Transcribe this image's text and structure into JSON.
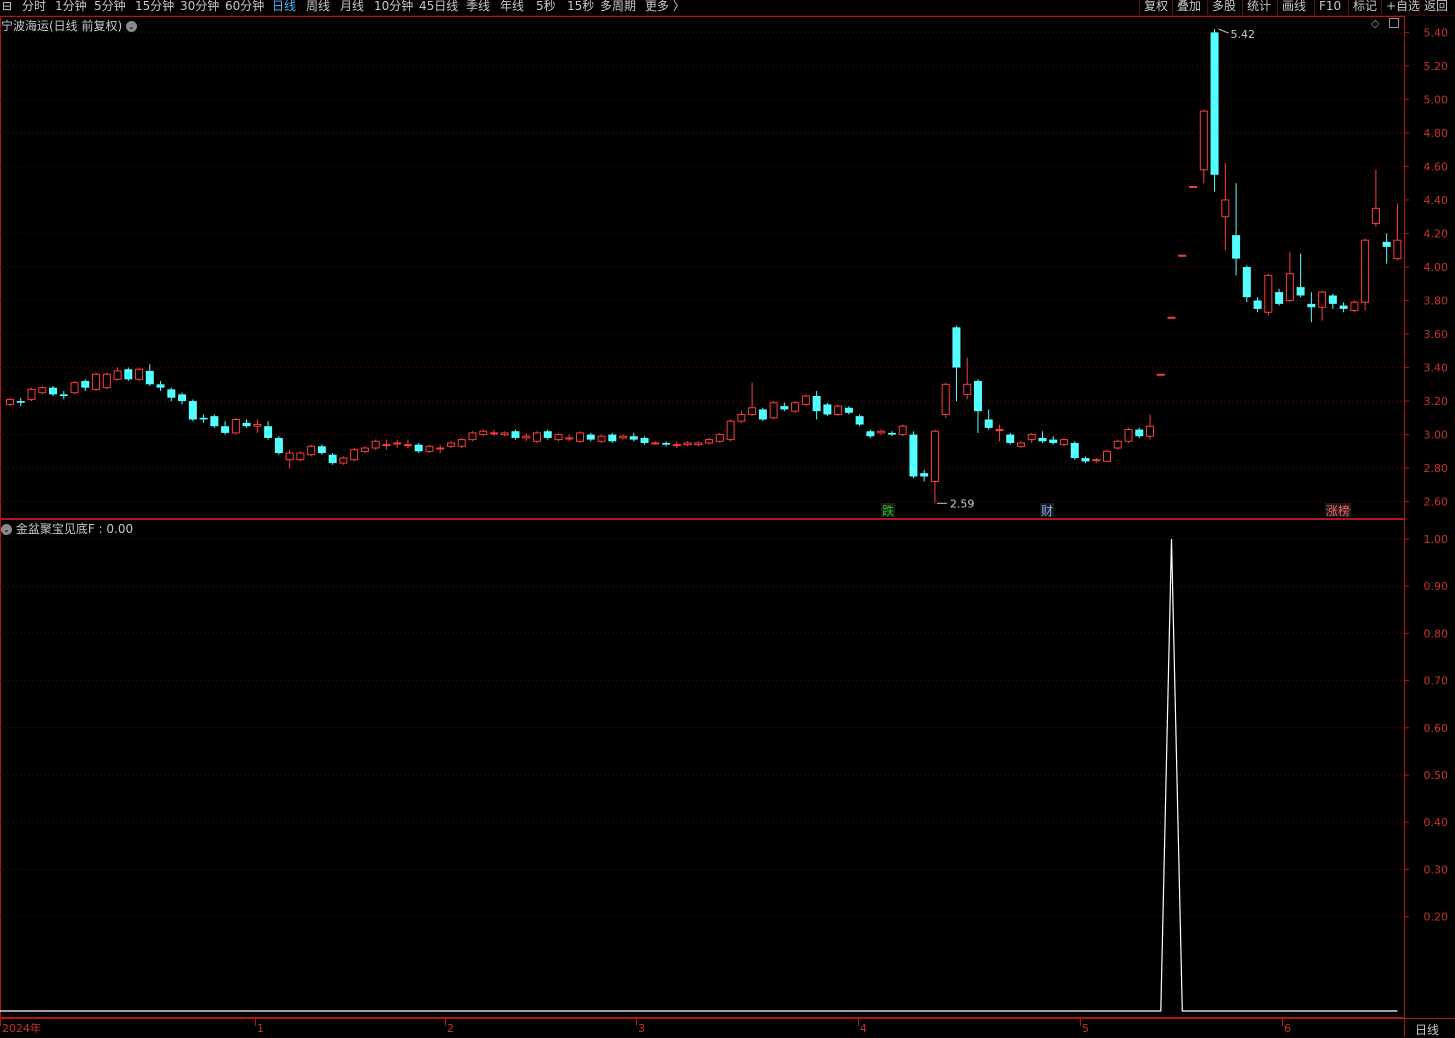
{
  "toolbar": {
    "periods": [
      "分时",
      "1分钟",
      "5分钟",
      "15分钟",
      "30分钟",
      "60分钟",
      "日线",
      "周线",
      "月线",
      "10分钟",
      "45日线",
      "季线",
      "年线",
      "5秒",
      "15秒",
      "多周期",
      "更多 〉"
    ],
    "active_period": "日线",
    "right_buttons": [
      "复权",
      "叠加",
      "多股",
      "统计",
      "画线",
      "F10",
      "标记",
      "+自选",
      "返回"
    ]
  },
  "main_panel": {
    "title": "宁波海运(日线 前复权)",
    "high_label": "5.42",
    "low_label": "2.59",
    "markers": [
      {
        "text": "跌",
        "color": "#27c227"
      },
      {
        "text": "财",
        "color": "#7fb0ff"
      },
      {
        "text": "涨榜",
        "color": "#ff6060"
      }
    ]
  },
  "indicator_panel": {
    "title": "金盆聚宝见底F : 0.00",
    "axis_ticks": [
      "1.00",
      "0.90",
      "0.80",
      "0.70",
      "0.60",
      "0.50",
      "0.40",
      "0.30",
      "0.20"
    ]
  },
  "time_axis": {
    "labels": [
      "2024年",
      "1",
      "2",
      "3",
      "4",
      "5",
      "6"
    ],
    "period_label": "日线"
  },
  "colors": {
    "up": "#ff3c3c",
    "down": "#54ffff",
    "grid": "#7a0000",
    "axis_text": "#c8342e",
    "frame": "#b01818"
  },
  "chart_data": [
    {
      "type": "candlestick",
      "name": "宁波海运",
      "ylim": [
        2.55,
        5.45
      ],
      "yticks": [
        2.6,
        2.8,
        3.0,
        3.2,
        3.4,
        3.6,
        3.8,
        4.0,
        4.2,
        4.4,
        4.6,
        4.8,
        5.0,
        5.2,
        5.4
      ],
      "candles": [
        {
          "o": 3.18,
          "c": 3.21,
          "h": 3.22,
          "l": 3.17
        },
        {
          "o": 3.2,
          "c": 3.19,
          "h": 3.22,
          "l": 3.17
        },
        {
          "o": 3.21,
          "c": 3.27,
          "h": 3.28,
          "l": 3.2
        },
        {
          "o": 3.25,
          "c": 3.28,
          "h": 3.29,
          "l": 3.24
        },
        {
          "o": 3.28,
          "c": 3.24,
          "h": 3.29,
          "l": 3.23
        },
        {
          "o": 3.24,
          "c": 3.23,
          "h": 3.26,
          "l": 3.21
        },
        {
          "o": 3.25,
          "c": 3.31,
          "h": 3.32,
          "l": 3.24
        },
        {
          "o": 3.32,
          "c": 3.28,
          "h": 3.33,
          "l": 3.26
        },
        {
          "o": 3.27,
          "c": 3.36,
          "h": 3.37,
          "l": 3.26
        },
        {
          "o": 3.28,
          "c": 3.36,
          "h": 3.37,
          "l": 3.27
        },
        {
          "o": 3.33,
          "c": 3.38,
          "h": 3.4,
          "l": 3.32
        },
        {
          "o": 3.39,
          "c": 3.33,
          "h": 3.4,
          "l": 3.32
        },
        {
          "o": 3.33,
          "c": 3.39,
          "h": 3.4,
          "l": 3.32
        },
        {
          "o": 3.38,
          "c": 3.3,
          "h": 3.42,
          "l": 3.29
        },
        {
          "o": 3.3,
          "c": 3.28,
          "h": 3.32,
          "l": 3.26
        },
        {
          "o": 3.27,
          "c": 3.22,
          "h": 3.28,
          "l": 3.2
        },
        {
          "o": 3.24,
          "c": 3.2,
          "h": 3.25,
          "l": 3.18
        },
        {
          "o": 3.2,
          "c": 3.09,
          "h": 3.21,
          "l": 3.08
        },
        {
          "o": 3.1,
          "c": 3.09,
          "h": 3.12,
          "l": 3.07
        },
        {
          "o": 3.11,
          "c": 3.05,
          "h": 3.12,
          "l": 3.04
        },
        {
          "o": 3.05,
          "c": 3.01,
          "h": 3.08,
          "l": 3.0
        },
        {
          "o": 3.01,
          "c": 3.09,
          "h": 3.1,
          "l": 3.0
        },
        {
          "o": 3.07,
          "c": 3.05,
          "h": 3.09,
          "l": 3.04
        },
        {
          "o": 3.05,
          "c": 3.06,
          "h": 3.09,
          "l": 3.01
        },
        {
          "o": 3.05,
          "c": 2.98,
          "h": 3.08,
          "l": 2.97
        },
        {
          "o": 2.98,
          "c": 2.89,
          "h": 2.99,
          "l": 2.88
        },
        {
          "o": 2.85,
          "c": 2.89,
          "h": 2.91,
          "l": 2.8
        },
        {
          "o": 2.85,
          "c": 2.89,
          "h": 2.9,
          "l": 2.84
        },
        {
          "o": 2.88,
          "c": 2.93,
          "h": 2.94,
          "l": 2.87
        },
        {
          "o": 2.93,
          "c": 2.89,
          "h": 2.94,
          "l": 2.88
        },
        {
          "o": 2.88,
          "c": 2.83,
          "h": 2.89,
          "l": 2.82
        },
        {
          "o": 2.83,
          "c": 2.86,
          "h": 2.87,
          "l": 2.82
        },
        {
          "o": 2.85,
          "c": 2.91,
          "h": 2.92,
          "l": 2.84
        },
        {
          "o": 2.9,
          "c": 2.92,
          "h": 2.93,
          "l": 2.89
        },
        {
          "o": 2.92,
          "c": 2.96,
          "h": 2.97,
          "l": 2.91
        },
        {
          "o": 2.94,
          "c": 2.94,
          "h": 2.97,
          "l": 2.91
        },
        {
          "o": 2.95,
          "c": 2.95,
          "h": 2.97,
          "l": 2.92
        },
        {
          "o": 2.94,
          "c": 2.94,
          "h": 2.97,
          "l": 2.92
        },
        {
          "o": 2.94,
          "c": 2.9,
          "h": 2.95,
          "l": 2.89
        },
        {
          "o": 2.9,
          "c": 2.93,
          "h": 2.94,
          "l": 2.89
        },
        {
          "o": 2.92,
          "c": 2.92,
          "h": 2.94,
          "l": 2.89
        },
        {
          "o": 2.93,
          "c": 2.95,
          "h": 2.96,
          "l": 2.92
        },
        {
          "o": 2.93,
          "c": 2.97,
          "h": 2.98,
          "l": 2.92
        },
        {
          "o": 2.97,
          "c": 3.01,
          "h": 3.02,
          "l": 2.96
        },
        {
          "o": 3.0,
          "c": 3.02,
          "h": 3.03,
          "l": 2.99
        },
        {
          "o": 3.01,
          "c": 3.01,
          "h": 3.03,
          "l": 2.99
        },
        {
          "o": 3.0,
          "c": 3.01,
          "h": 3.02,
          "l": 2.99
        },
        {
          "o": 3.02,
          "c": 2.98,
          "h": 3.03,
          "l": 2.97
        },
        {
          "o": 2.98,
          "c": 2.99,
          "h": 3.01,
          "l": 2.96
        },
        {
          "o": 2.96,
          "c": 3.01,
          "h": 3.02,
          "l": 2.95
        },
        {
          "o": 3.02,
          "c": 2.98,
          "h": 3.03,
          "l": 2.97
        },
        {
          "o": 2.97,
          "c": 3.0,
          "h": 3.01,
          "l": 2.96
        },
        {
          "o": 2.98,
          "c": 2.98,
          "h": 3.0,
          "l": 2.96
        },
        {
          "o": 2.96,
          "c": 3.01,
          "h": 3.02,
          "l": 2.95
        },
        {
          "o": 3.0,
          "c": 2.97,
          "h": 3.01,
          "l": 2.96
        },
        {
          "o": 2.96,
          "c": 2.99,
          "h": 3.0,
          "l": 2.95
        },
        {
          "o": 3.0,
          "c": 2.96,
          "h": 3.01,
          "l": 2.95
        },
        {
          "o": 2.98,
          "c": 2.99,
          "h": 3.0,
          "l": 2.97
        },
        {
          "o": 2.99,
          "c": 2.97,
          "h": 3.01,
          "l": 2.96
        },
        {
          "o": 2.98,
          "c": 2.95,
          "h": 2.99,
          "l": 2.94
        },
        {
          "o": 2.95,
          "c": 2.95,
          "h": 2.96,
          "l": 2.94
        },
        {
          "o": 2.95,
          "c": 2.94,
          "h": 2.96,
          "l": 2.93
        },
        {
          "o": 2.94,
          "c": 2.94,
          "h": 2.96,
          "l": 2.92
        },
        {
          "o": 2.94,
          "c": 2.95,
          "h": 2.96,
          "l": 2.93
        },
        {
          "o": 2.94,
          "c": 2.95,
          "h": 2.96,
          "l": 2.93
        },
        {
          "o": 2.95,
          "c": 2.97,
          "h": 2.98,
          "l": 2.94
        },
        {
          "o": 2.96,
          "c": 3.0,
          "h": 3.01,
          "l": 2.95
        },
        {
          "o": 2.97,
          "c": 3.08,
          "h": 3.09,
          "l": 2.96
        },
        {
          "o": 3.08,
          "c": 3.12,
          "h": 3.14,
          "l": 3.07
        },
        {
          "o": 3.12,
          "c": 3.16,
          "h": 3.31,
          "l": 3.11
        },
        {
          "o": 3.15,
          "c": 3.09,
          "h": 3.16,
          "l": 3.08
        },
        {
          "o": 3.1,
          "c": 3.19,
          "h": 3.2,
          "l": 3.09
        },
        {
          "o": 3.17,
          "c": 3.15,
          "h": 3.19,
          "l": 3.14
        },
        {
          "o": 3.14,
          "c": 3.19,
          "h": 3.2,
          "l": 3.13
        },
        {
          "o": 3.18,
          "c": 3.23,
          "h": 3.24,
          "l": 3.17
        },
        {
          "o": 3.23,
          "c": 3.14,
          "h": 3.26,
          "l": 3.09
        },
        {
          "o": 3.18,
          "c": 3.12,
          "h": 3.19,
          "l": 3.11
        },
        {
          "o": 3.12,
          "c": 3.17,
          "h": 3.18,
          "l": 3.11
        },
        {
          "o": 3.16,
          "c": 3.13,
          "h": 3.17,
          "l": 3.12
        },
        {
          "o": 3.11,
          "c": 3.06,
          "h": 3.12,
          "l": 3.05
        },
        {
          "o": 3.02,
          "c": 2.99,
          "h": 3.03,
          "l": 2.98
        },
        {
          "o": 3.01,
          "c": 3.02,
          "h": 3.03,
          "l": 3.0
        },
        {
          "o": 3.01,
          "c": 3.0,
          "h": 3.02,
          "l": 2.99
        },
        {
          "o": 3.0,
          "c": 3.05,
          "h": 3.06,
          "l": 2.99
        },
        {
          "o": 3.0,
          "c": 2.75,
          "h": 3.02,
          "l": 2.74
        },
        {
          "o": 2.77,
          "c": 2.75,
          "h": 2.79,
          "l": 2.72
        },
        {
          "o": 2.72,
          "c": 3.02,
          "h": 3.03,
          "l": 2.59
        },
        {
          "o": 3.12,
          "c": 3.3,
          "h": 3.31,
          "l": 3.1
        },
        {
          "o": 3.64,
          "c": 3.4,
          "h": 3.65,
          "l": 3.2
        },
        {
          "o": 3.24,
          "c": 3.3,
          "h": 3.46,
          "l": 3.21
        },
        {
          "o": 3.32,
          "c": 3.14,
          "h": 3.33,
          "l": 3.01
        },
        {
          "o": 3.09,
          "c": 3.04,
          "h": 3.15,
          "l": 3.03
        },
        {
          "o": 3.03,
          "c": 3.03,
          "h": 3.06,
          "l": 2.96
        },
        {
          "o": 3.0,
          "c": 2.95,
          "h": 3.01,
          "l": 2.94
        },
        {
          "o": 2.93,
          "c": 2.95,
          "h": 2.96,
          "l": 2.92
        },
        {
          "o": 2.97,
          "c": 3.0,
          "h": 3.01,
          "l": 2.95
        },
        {
          "o": 2.98,
          "c": 2.96,
          "h": 3.02,
          "l": 2.95
        },
        {
          "o": 2.97,
          "c": 2.95,
          "h": 2.99,
          "l": 2.94
        },
        {
          "o": 2.94,
          "c": 2.97,
          "h": 2.98,
          "l": 2.93
        },
        {
          "o": 2.95,
          "c": 2.86,
          "h": 2.96,
          "l": 2.85
        },
        {
          "o": 2.86,
          "c": 2.84,
          "h": 2.87,
          "l": 2.83
        },
        {
          "o": 2.85,
          "c": 2.85,
          "h": 2.86,
          "l": 2.83
        },
        {
          "o": 2.84,
          "c": 2.9,
          "h": 2.91,
          "l": 2.84
        },
        {
          "o": 2.92,
          "c": 2.96,
          "h": 2.97,
          "l": 2.91
        },
        {
          "o": 2.96,
          "c": 3.03,
          "h": 3.04,
          "l": 2.95
        },
        {
          "o": 3.03,
          "c": 2.99,
          "h": 3.04,
          "l": 2.98
        },
        {
          "o": 2.99,
          "c": 3.05,
          "h": 3.12,
          "l": 2.97
        },
        {
          "o": 3.36,
          "c": 3.36,
          "h": 3.36,
          "l": 3.36
        },
        {
          "o": 3.7,
          "c": 3.7,
          "h": 3.7,
          "l": 3.7
        },
        {
          "o": 4.07,
          "c": 4.07,
          "h": 4.07,
          "l": 4.07
        },
        {
          "o": 4.48,
          "c": 4.48,
          "h": 4.48,
          "l": 4.48
        },
        {
          "o": 4.58,
          "c": 4.93,
          "h": 4.94,
          "l": 4.5
        },
        {
          "o": 5.4,
          "c": 4.55,
          "h": 5.42,
          "l": 4.45
        },
        {
          "o": 4.3,
          "c": 4.4,
          "h": 4.62,
          "l": 4.1
        },
        {
          "o": 4.19,
          "c": 4.05,
          "h": 4.5,
          "l": 3.95
        },
        {
          "o": 4.0,
          "c": 3.82,
          "h": 4.01,
          "l": 3.79
        },
        {
          "o": 3.8,
          "c": 3.75,
          "h": 3.82,
          "l": 3.73
        },
        {
          "o": 3.73,
          "c": 3.95,
          "h": 3.96,
          "l": 3.71
        },
        {
          "o": 3.85,
          "c": 3.78,
          "h": 3.87,
          "l": 3.77
        },
        {
          "o": 3.8,
          "c": 3.96,
          "h": 4.09,
          "l": 3.79
        },
        {
          "o": 3.88,
          "c": 3.83,
          "h": 4.08,
          "l": 3.82
        },
        {
          "o": 3.78,
          "c": 3.76,
          "h": 3.85,
          "l": 3.67
        },
        {
          "o": 3.76,
          "c": 3.85,
          "h": 3.86,
          "l": 3.68
        },
        {
          "o": 3.83,
          "c": 3.78,
          "h": 3.84,
          "l": 3.75
        },
        {
          "o": 3.77,
          "c": 3.75,
          "h": 3.79,
          "l": 3.73
        },
        {
          "o": 3.74,
          "c": 3.79,
          "h": 3.8,
          "l": 3.73
        },
        {
          "o": 3.79,
          "c": 4.16,
          "h": 4.17,
          "l": 3.74
        },
        {
          "o": 4.26,
          "c": 4.35,
          "h": 4.58,
          "l": 4.24
        },
        {
          "o": 4.15,
          "c": 4.12,
          "h": 4.2,
          "l": 4.02
        },
        {
          "o": 4.05,
          "c": 4.16,
          "h": 4.38,
          "l": 4.04
        }
      ]
    },
    {
      "type": "line",
      "name": "金盆聚宝见底F",
      "ylim": [
        0,
        1.05
      ],
      "yticks": [
        0.2,
        0.3,
        0.4,
        0.5,
        0.6,
        0.7,
        0.8,
        0.9,
        1.0
      ],
      "peak_index": 108,
      "values_note_count": 131
    }
  ]
}
